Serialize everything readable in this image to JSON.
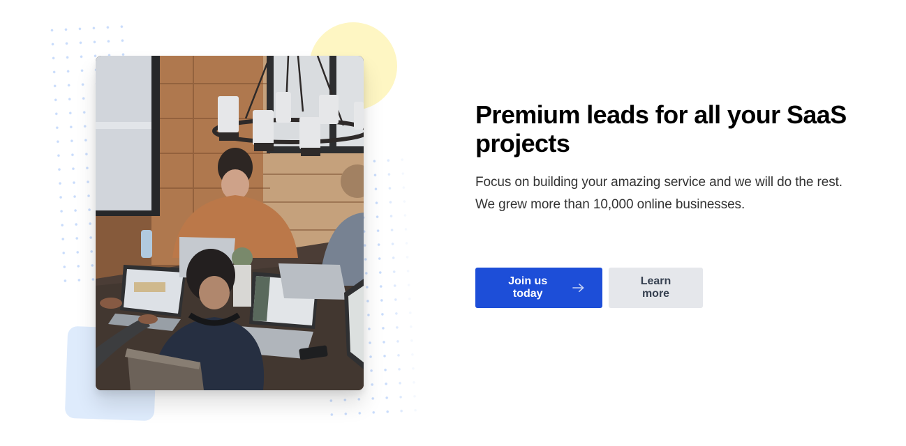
{
  "hero": {
    "headline": "Premium leads for all your SaaS projects",
    "description_lines": [
      "Focus on building your amazing service and we will do the rest.",
      "We grew more than 10,000 online businesses."
    ],
    "primary_button": {
      "label": "Join us today",
      "icon": "arrow-right-icon"
    },
    "secondary_button": {
      "label": "Learn more"
    },
    "image": {
      "description": "People working on laptops around a wooden table under a candle chandelier"
    }
  },
  "colors": {
    "primary": "#1d4ed8",
    "secondary_bg": "#e5e7eb",
    "secondary_text": "#374151",
    "decor_yellow": "#fef6c3",
    "decor_blue": "#deebfc",
    "dots": "#c9dcfb",
    "headline": "#000000",
    "body_text": "#333333"
  }
}
